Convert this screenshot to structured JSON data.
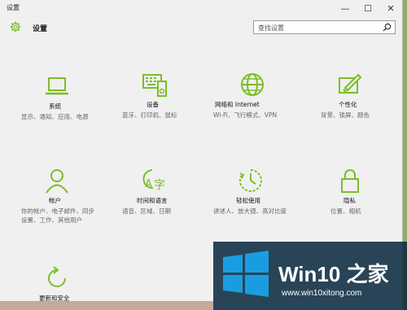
{
  "window": {
    "title": "设置"
  },
  "header": {
    "title": "设置",
    "icon": "gear-icon"
  },
  "search": {
    "placeholder": "查找设置"
  },
  "accent": "#7cbd27",
  "tiles": [
    {
      "name": "系统",
      "desc": "显示、通知、应用、电源",
      "icon": "laptop-icon"
    },
    {
      "name": "设备",
      "desc": "蓝牙、打印机、鼠标",
      "icon": "devices-icon"
    },
    {
      "name": "网络和 Internet",
      "desc": "Wi-Fi、飞行模式、VPN",
      "icon": "globe-icon"
    },
    {
      "name": "个性化",
      "desc": "背景、锁屏、颜色",
      "icon": "paint-icon"
    },
    {
      "name": "帐户",
      "desc": "你的帐户、电子邮件、同步设置、工作、其他用户",
      "icon": "person-icon"
    },
    {
      "name": "时间和语言",
      "desc": "语音、区域、日期",
      "icon": "time-language-icon"
    },
    {
      "name": "轻松使用",
      "desc": "讲述人、放大镜、高对比度",
      "icon": "ease-of-access-icon"
    },
    {
      "name": "隐私",
      "desc": "位置、相机",
      "icon": "lock-icon"
    },
    {
      "name": "更新和安全",
      "desc": "",
      "icon": "refresh-icon"
    }
  ],
  "watermark": {
    "brand": "Win10 之家",
    "url": "www.win10xitong.com"
  }
}
